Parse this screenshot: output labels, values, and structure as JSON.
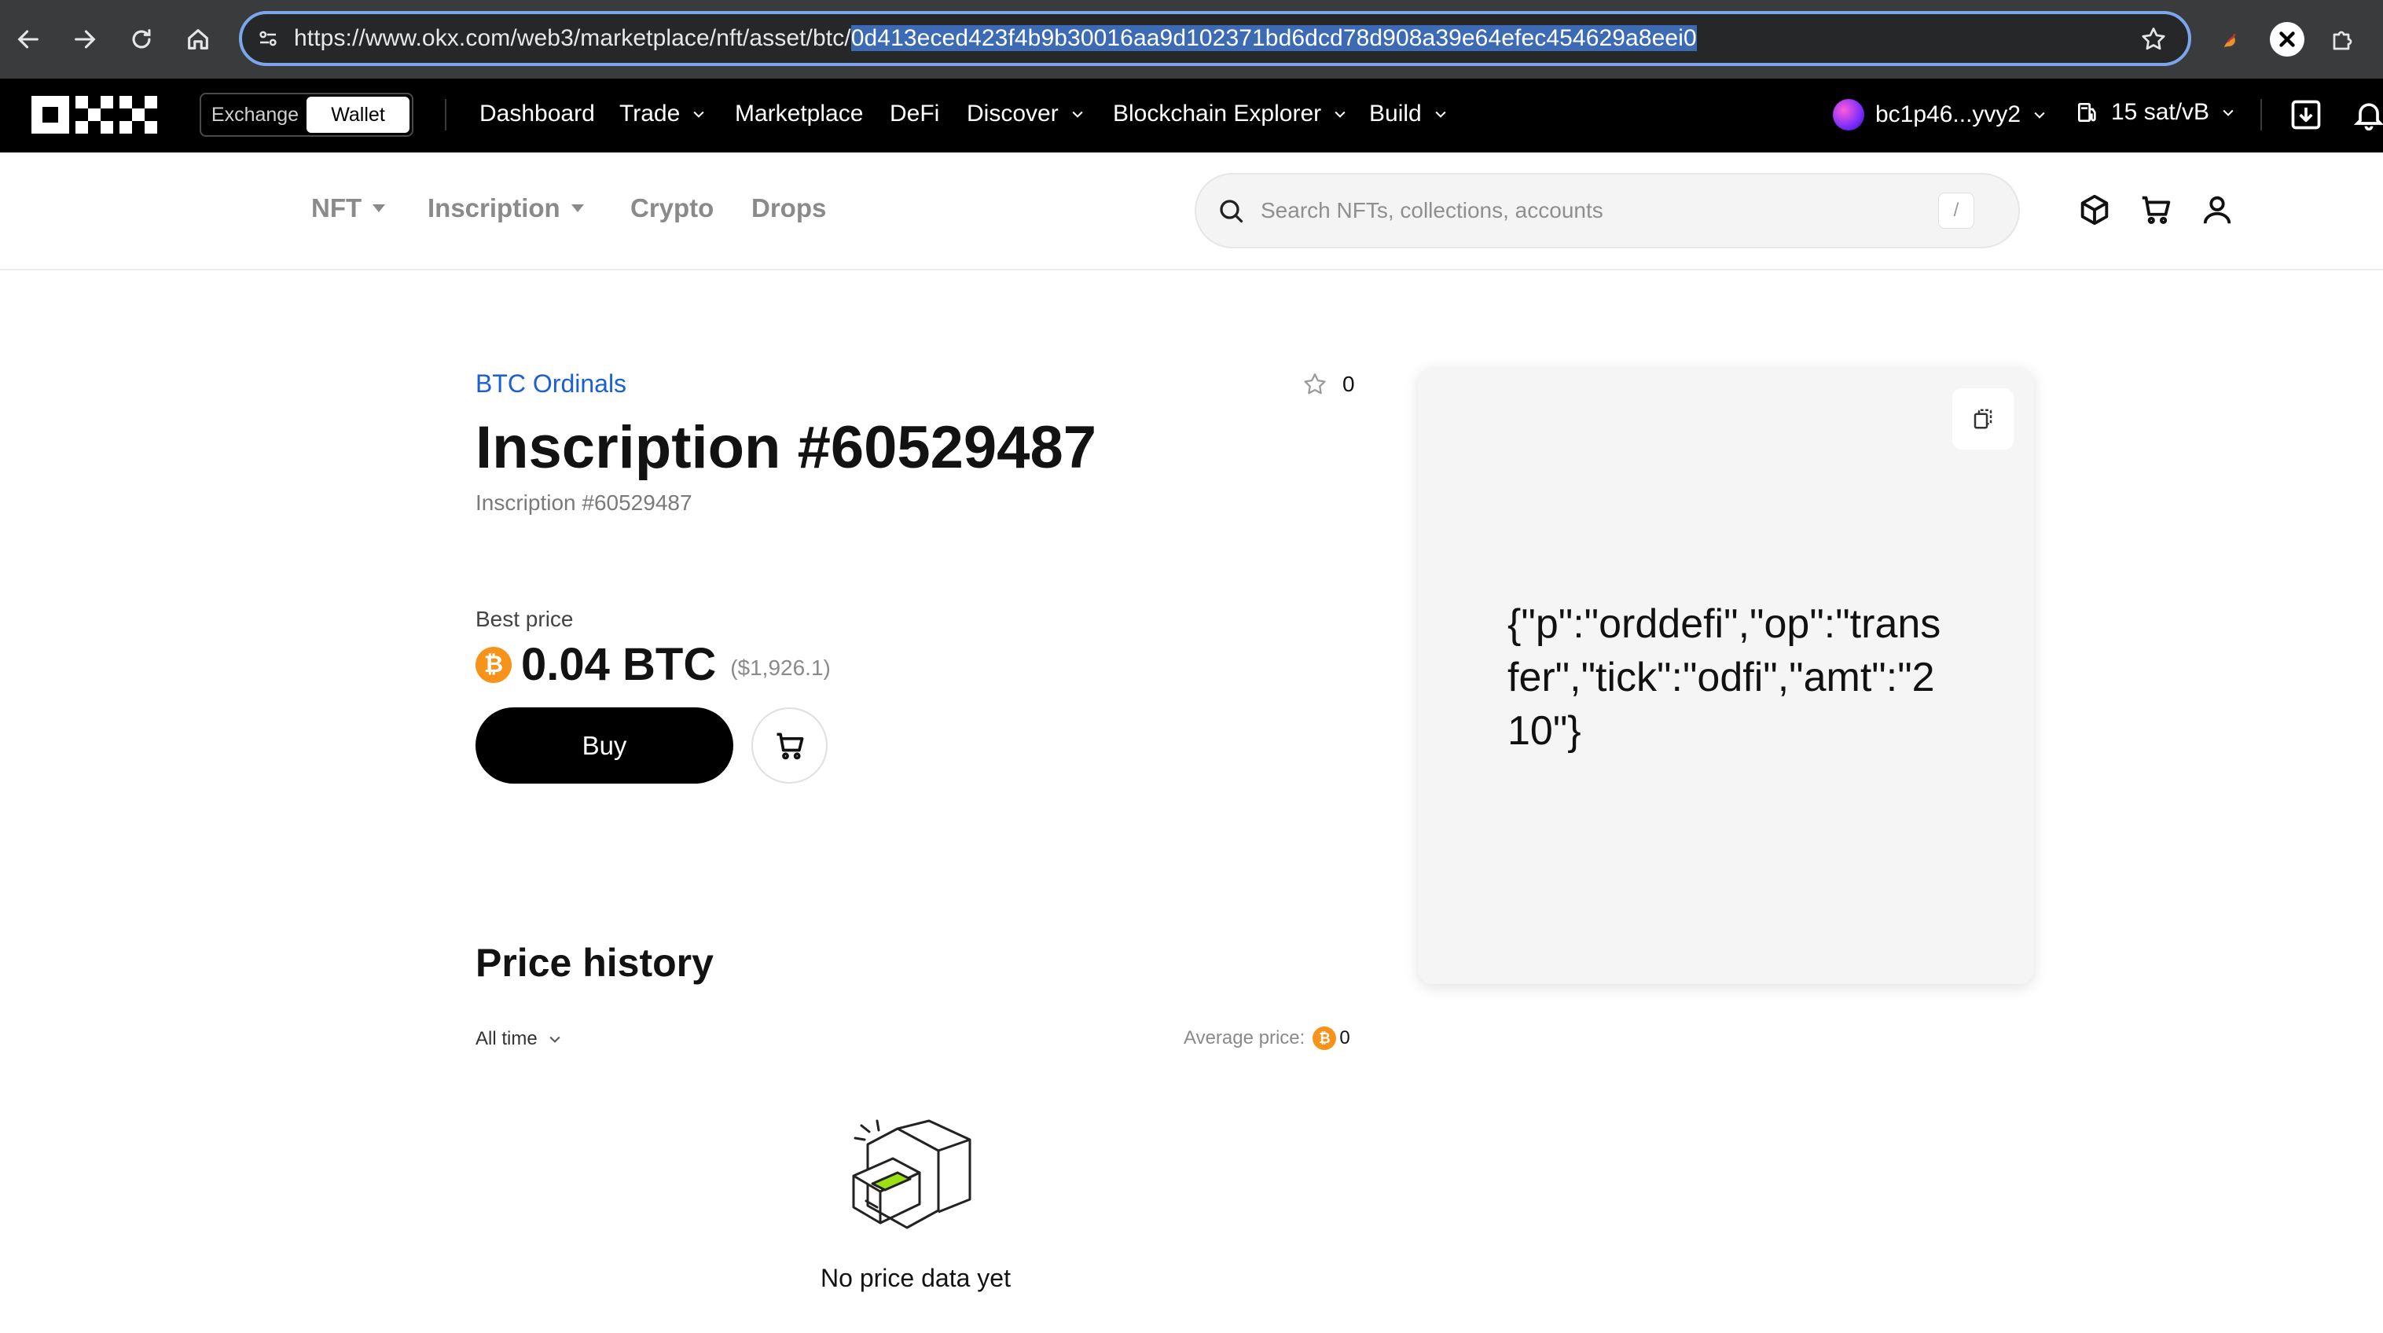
{
  "browser": {
    "url_prefix": "https://www.okx.com/web3/marketplace/nft/asset/btc/",
    "url_selected": "0d413eced423f4b9b30016aa9d102371bd6dcd78d908a39e64efec454629a8eei0"
  },
  "okx_nav": {
    "mode_exchange": "Exchange",
    "mode_wallet": "Wallet",
    "items": [
      "Dashboard",
      "Trade",
      "Marketplace",
      "DeFi",
      "Discover",
      "Blockchain Explorer",
      "Build"
    ],
    "account": "bc1p46...yvy2",
    "fee": "15 sat/vB"
  },
  "subnav": {
    "items": [
      "NFT",
      "Inscription",
      "Crypto",
      "Drops"
    ],
    "search_placeholder": "Search NFTs, collections, accounts",
    "search_shortcut": "/"
  },
  "asset": {
    "collection": "BTC Ordinals",
    "title": "Inscription #60529487",
    "subtitle": "Inscription #60529487",
    "favorites": "0",
    "best_price_label": "Best price",
    "price": "0.04 BTC",
    "price_usd": "($1,926.1)",
    "buy_label": "Buy",
    "content": "{\"p\":\"orddefi\",\"op\":\"transfer\",\"tick\":\"odfi\",\"amt\":\"210\"}"
  },
  "price_history": {
    "title": "Price history",
    "range": "All time",
    "avg_label": "Average price:",
    "avg_value": "0",
    "empty_text": "No price data yet"
  },
  "colors": {
    "accent_link": "#1a5fd9",
    "btc_orange": "#f7931a",
    "nav_bg": "#000000"
  }
}
